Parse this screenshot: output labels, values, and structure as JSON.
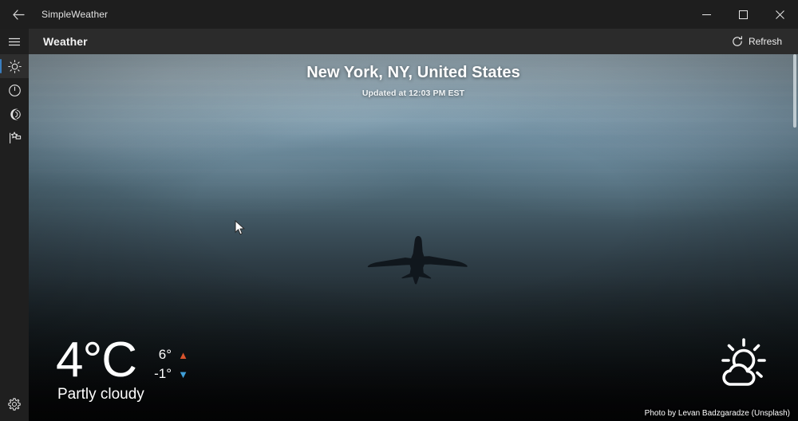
{
  "window": {
    "app_title": "SimpleWeather",
    "back_icon": "back-arrow-icon",
    "minimize_label": "Minimize",
    "maximize_label": "Maximize",
    "close_label": "Close"
  },
  "rail": {
    "menu_label": "Menu",
    "items": [
      {
        "name": "forecast",
        "label": "Forecast",
        "icon": "sun-icon",
        "active": true
      },
      {
        "name": "hourly",
        "label": "Hourly Forecast",
        "icon": "clock-icon",
        "active": false
      },
      {
        "name": "radar",
        "label": "Radar",
        "icon": "radar-icon",
        "active": false
      },
      {
        "name": "alerts",
        "label": "Weather Alerts",
        "icon": "flag-star-icon",
        "active": false
      }
    ],
    "settings_label": "Settings",
    "settings_icon": "gear-icon"
  },
  "header": {
    "title": "Weather",
    "refresh_label": "Refresh",
    "refresh_icon": "refresh-icon"
  },
  "location": {
    "name": "New York, NY, United States",
    "updated": "Updated at 12:03 PM EST"
  },
  "current": {
    "temperature": "4°C",
    "high": "6°",
    "low": "-1°",
    "high_arrow": "▲",
    "low_arrow": "▼",
    "condition": "Partly cloudy",
    "condition_icon": "sun-behind-cloud-icon",
    "high_color": "#d9532c",
    "low_color": "#3f9fd8"
  },
  "photo": {
    "credit": "Photo by Levan Badzgaradze (Unsplash)"
  },
  "theme": {
    "accent": "#3a7ebf",
    "titlebar_bg": "#1e1e1e",
    "rail_bg": "#1f1f1f",
    "header_bg": "#2b2b2b"
  }
}
